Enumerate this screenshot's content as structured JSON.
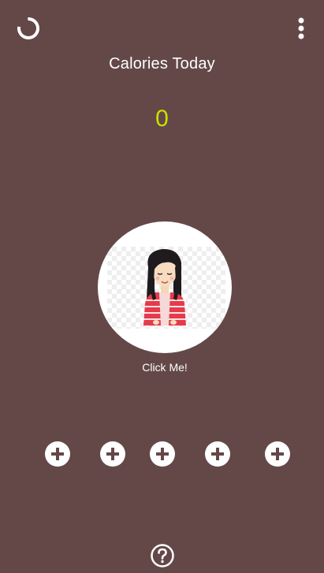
{
  "header": {
    "title": "Calories Today",
    "reset_icon": "circle-refresh-icon",
    "menu_icon": "more-vertical-icon"
  },
  "counter": {
    "value": "0",
    "color": "#c8e000"
  },
  "avatar": {
    "label": "Click Me!",
    "icon": "girl-avatar-illustration"
  },
  "add_buttons": [
    {
      "icon": "plus-icon"
    },
    {
      "icon": "plus-icon"
    },
    {
      "icon": "plus-icon"
    },
    {
      "icon": "plus-icon"
    },
    {
      "icon": "plus-icon"
    }
  ],
  "footer": {
    "help_icon": "question-circle-icon"
  },
  "colors": {
    "background": "#644848",
    "accent": "#c8e000",
    "foreground": "#ffffff"
  }
}
